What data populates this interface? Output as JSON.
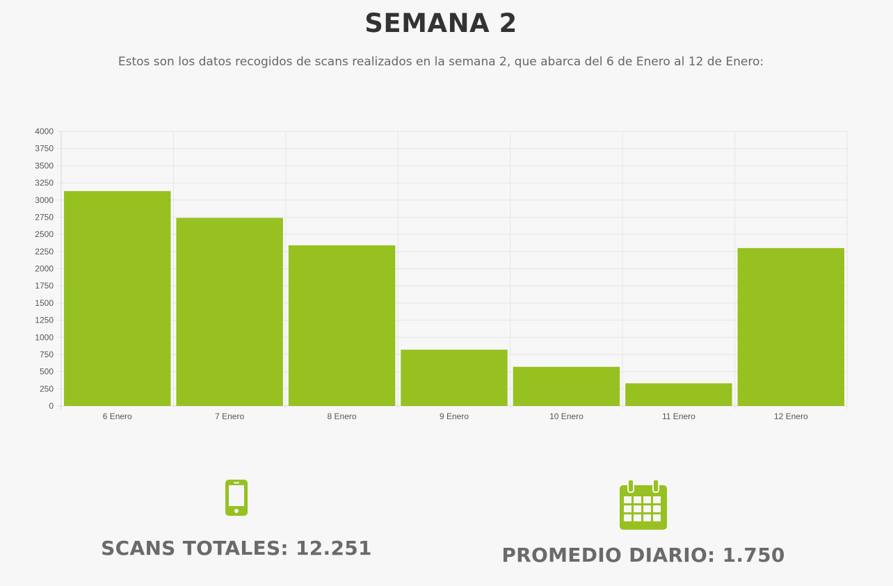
{
  "header": {
    "title": "SEMANA 2",
    "subtitle": "Estos son los datos recogidos de scans realizados en la semana 2, que abarca del 6 de Enero al 12 de Enero:"
  },
  "chart_data": {
    "type": "bar",
    "title": "",
    "xlabel": "",
    "ylabel": "",
    "categories": [
      "6 Enero",
      "7 Enero",
      "8 Enero",
      "9 Enero",
      "10 Enero",
      "11 Enero",
      "12 Enero"
    ],
    "values": [
      3130,
      2740,
      2340,
      820,
      570,
      330,
      2300
    ],
    "ylim": [
      0,
      4000
    ],
    "yticks": [
      0,
      250,
      500,
      750,
      1000,
      1250,
      1500,
      1750,
      2000,
      2250,
      2500,
      2750,
      3000,
      3250,
      3500,
      3750,
      4000
    ],
    "grid": true,
    "legend": "none",
    "bar_color": "#96c120"
  },
  "stats": {
    "total": {
      "icon": "smartphone-icon",
      "text": "SCANS TOTALES: 12.251"
    },
    "average": {
      "icon": "calendar-icon",
      "text": "PROMEDIO DIARIO: 1.750"
    }
  },
  "colors": {
    "accent": "#96c120",
    "title": "#333333",
    "stat_text": "#6a6a6a",
    "background": "#f7f7f7"
  }
}
